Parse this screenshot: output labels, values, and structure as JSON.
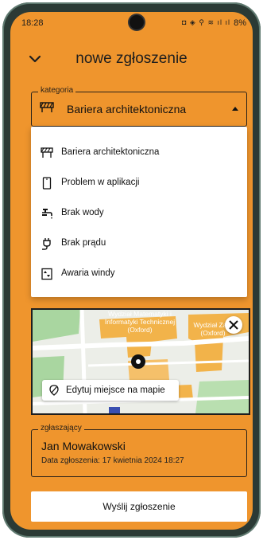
{
  "status_bar": {
    "time": "18:28",
    "icons": "◘ ◈ ⚲ ≋ ıl ıl",
    "battery": "8%"
  },
  "header": {
    "title": "nowe zgłoszenie",
    "back_icon": "chevron-down-icon"
  },
  "category": {
    "legend": "kategoria",
    "value": "Bariera architektoniczna",
    "icon": "barrier-icon"
  },
  "dropdown": {
    "items": [
      {
        "label": "Bariera architektoniczna",
        "icon": "barrier-icon"
      },
      {
        "label": "Problem w aplikacji",
        "icon": "phone-icon"
      },
      {
        "label": "Brak wody",
        "icon": "faucet-icon"
      },
      {
        "label": "Brak prądu",
        "icon": "plug-icon"
      },
      {
        "label": "Awaria windy",
        "icon": "elevator-icon"
      }
    ]
  },
  "map": {
    "label_left": "Wydział Matematyki i Informatyki Technicznej (Oxford)",
    "label_right": "Wydział Za... (Oxford)",
    "edit_button": "Edytuj miejsce na mapie"
  },
  "reporter": {
    "legend": "zgłaszający",
    "name": "Jan Mowakowski",
    "date": "Data zgłoszenia: 17 kwietnia 2024 18:27"
  },
  "submit": {
    "label": "Wyślij zgłoszenie"
  },
  "colors": {
    "accent": "#ef952d",
    "frame": "#2b3a35",
    "building": "#f2b34a",
    "road": "#ffffff",
    "green": "#a9d6a0"
  }
}
